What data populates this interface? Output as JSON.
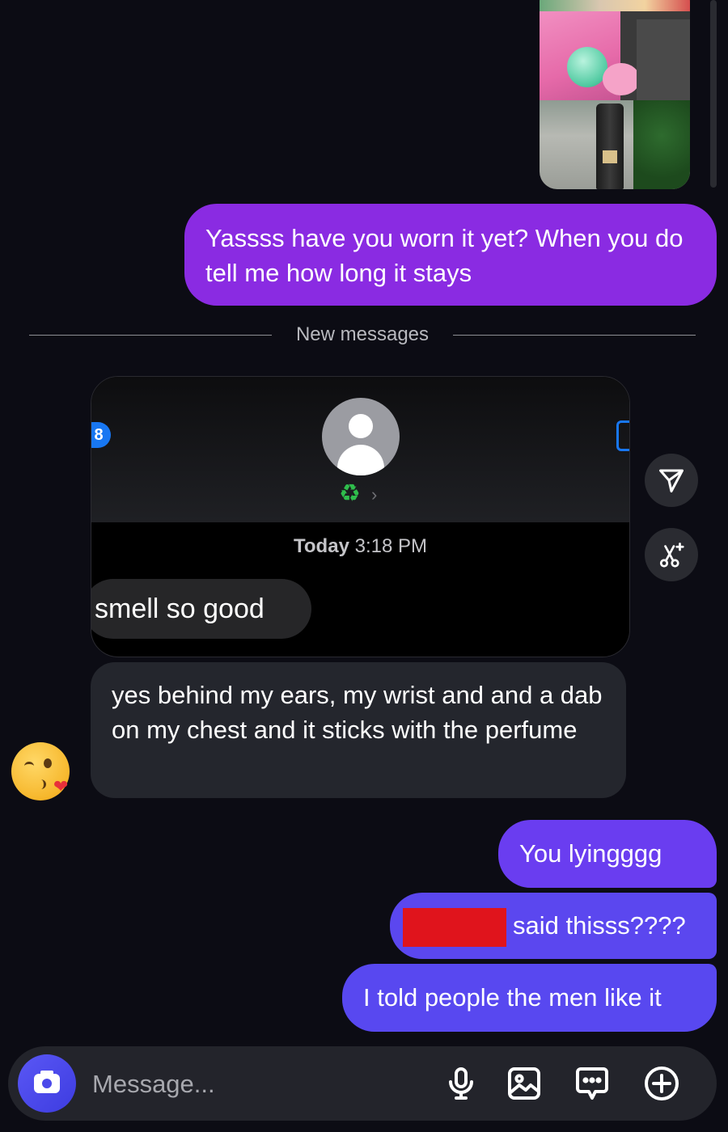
{
  "messages": {
    "out_1": "Yassss have you worn it yet? When you do tell me how long it stays",
    "divider": "New messages",
    "screenshot": {
      "badge": "8",
      "time_day": "Today",
      "time_clock": "3:18 PM",
      "preview_text": "smell so good"
    },
    "in_1": "yes behind my ears, my wrist and and a dab on my chest and it sticks with the perfume",
    "out_2": "You lyingggg",
    "out_3_suffix": "said thisss????",
    "out_4": "I told people the men like it"
  },
  "composer": {
    "placeholder": "Message..."
  },
  "icons": {
    "share": "share-icon",
    "edit": "edit-sparkle-icon",
    "camera": "camera-icon",
    "mic": "microphone-icon",
    "gallery": "gallery-icon",
    "sticker": "chat-sticker-icon",
    "plus": "plus-circle-icon",
    "reaction": "kissing-face-emoji"
  },
  "colors": {
    "background": "#0c0c14",
    "outgoing_purple": "#8a2be2",
    "outgoing_blue": "#5848f0",
    "incoming": "#24262d",
    "redaction": "#e0141c"
  }
}
